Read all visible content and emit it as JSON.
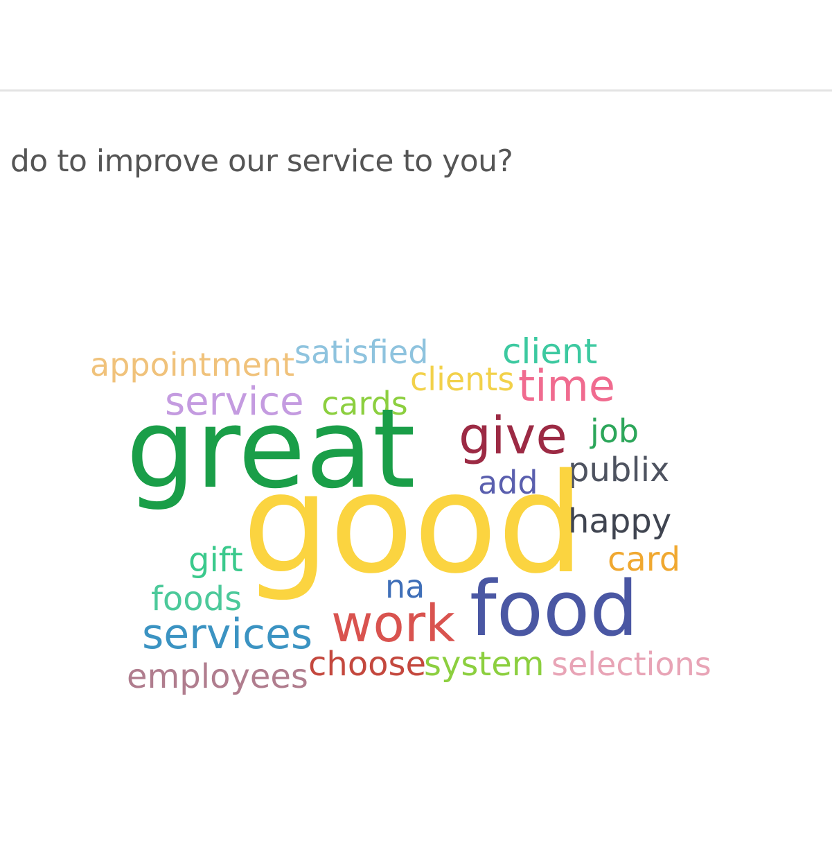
{
  "question": {
    "text": "- do to improve our service to you?"
  },
  "word_cloud": {
    "words": [
      {
        "text": "appointment",
        "color": "#f0c27b"
      },
      {
        "text": "satisfied",
        "color": "#8ec3de"
      },
      {
        "text": "client",
        "color": "#3cc9a0"
      },
      {
        "text": "clients",
        "color": "#f2d14a"
      },
      {
        "text": "time",
        "color": "#f06b8f"
      },
      {
        "text": "service",
        "color": "#c49be0"
      },
      {
        "text": "cards",
        "color": "#8ccf3f"
      },
      {
        "text": "great",
        "color": "#1a9e48"
      },
      {
        "text": "give",
        "color": "#9c2a44"
      },
      {
        "text": "job",
        "color": "#2ca65a"
      },
      {
        "text": "add",
        "color": "#5a5fae"
      },
      {
        "text": "publix",
        "color": "#4e5360"
      },
      {
        "text": "good",
        "color": "#fbd440"
      },
      {
        "text": "happy",
        "color": "#3f4450"
      },
      {
        "text": "gift",
        "color": "#3ac98c"
      },
      {
        "text": "card",
        "color": "#f0a830"
      },
      {
        "text": "foods",
        "color": "#4cc99a"
      },
      {
        "text": "na",
        "color": "#3f6fb8"
      },
      {
        "text": "services",
        "color": "#3b93c2"
      },
      {
        "text": "work",
        "color": "#d9534f"
      },
      {
        "text": "food",
        "color": "#4a57a3"
      },
      {
        "text": "employees",
        "color": "#b07d8e"
      },
      {
        "text": "choose",
        "color": "#c4483e"
      },
      {
        "text": "system",
        "color": "#8ccf3f"
      },
      {
        "text": "selections",
        "color": "#e8a4b6"
      }
    ]
  }
}
